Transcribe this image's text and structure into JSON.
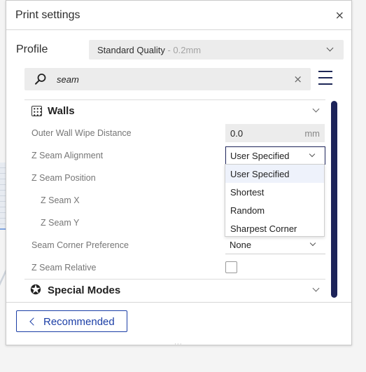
{
  "window": {
    "title": "Print settings",
    "close_glyph": "×"
  },
  "profile": {
    "label": "Profile",
    "value": "Standard Quality",
    "separator": " - ",
    "variant": "0.2mm"
  },
  "search": {
    "value": "seam",
    "clear_glyph": "×"
  },
  "sections": {
    "walls": {
      "title": "Walls",
      "icon": "walls-grid-icon"
    },
    "special_modes": {
      "title": "Special Modes",
      "icon": "star-icon",
      "icon_glyph": "✪"
    }
  },
  "settings": {
    "outer_wall_wipe_distance": {
      "label": "Outer Wall Wipe Distance",
      "value": "0.0",
      "unit": "mm"
    },
    "z_seam_alignment": {
      "label": "Z Seam Alignment",
      "value": "User Specified"
    },
    "z_seam_position": {
      "label": "Z Seam Position"
    },
    "z_seam_x": {
      "label": "Z Seam X"
    },
    "z_seam_y": {
      "label": "Z Seam Y"
    },
    "seam_corner_preference": {
      "label": "Seam Corner Preference",
      "value": "None"
    },
    "z_seam_relative": {
      "label": "Z Seam Relative",
      "checked": false
    }
  },
  "dropdown_options": [
    "User Specified",
    "Shortest",
    "Random",
    "Sharpest Corner"
  ],
  "footer": {
    "recommended_label": "Recommended",
    "resize_glyph": "···"
  },
  "colors": {
    "accent": "#1b3ea6",
    "scrollbar": "#1c2359"
  }
}
